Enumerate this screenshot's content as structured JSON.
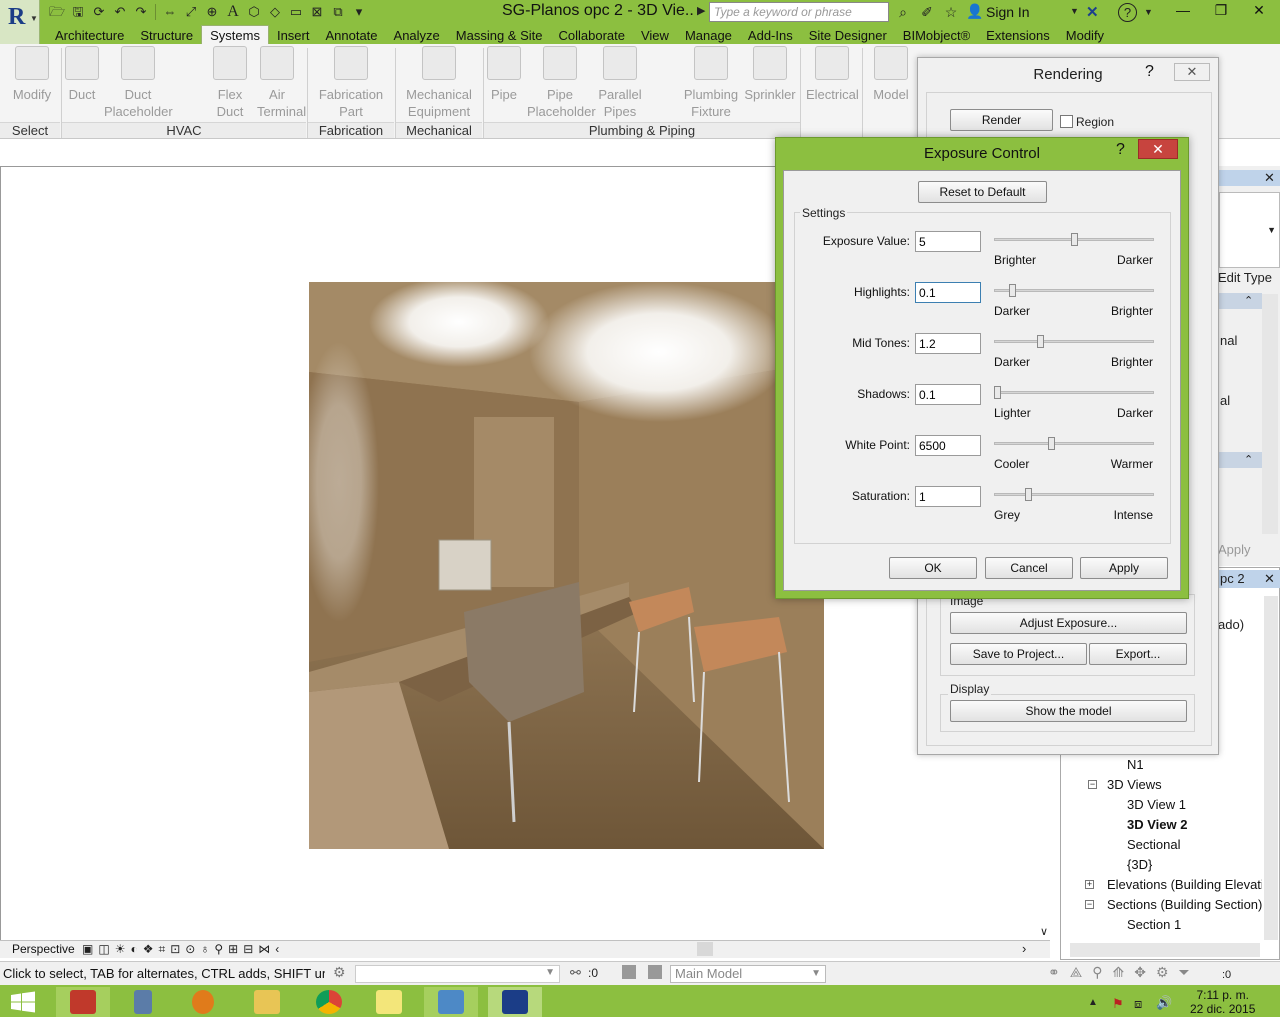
{
  "window": {
    "doc_title": "SG-Planos opc 2 - 3D Vie...",
    "search_placeholder": "Type a keyword or phrase",
    "signin_label": "Sign In",
    "minimize_label": "—",
    "restore_label": "❐",
    "close_label": "✕"
  },
  "menu_tabs": [
    "Architecture",
    "Structure",
    "Systems",
    "Insert",
    "Annotate",
    "Analyze",
    "Massing & Site",
    "Collaborate",
    "View",
    "Manage",
    "Add-Ins",
    "Site Designer",
    "BIMobject®",
    "Extensions",
    "Modify"
  ],
  "active_tab": "Systems",
  "ribbon": {
    "buttons": [
      {
        "label1": "Modify",
        "label2": ""
      },
      {
        "label1": "Duct",
        "label2": ""
      },
      {
        "label1": "Duct",
        "label2": "Placeholder"
      },
      {
        "label1": "Flex",
        "label2": "Duct"
      },
      {
        "label1": "Air",
        "label2": "Terminal"
      },
      {
        "label1": "Fabrication",
        "label2": "Part"
      },
      {
        "label1": "Mechanical",
        "label2": "Equipment"
      },
      {
        "label1": "Pipe",
        "label2": ""
      },
      {
        "label1": "Pipe",
        "label2": "Placeholder"
      },
      {
        "label1": "Parallel",
        "label2": "Pipes"
      },
      {
        "label1": "Plumbing",
        "label2": "Fixture"
      },
      {
        "label1": "Sprinkler",
        "label2": ""
      },
      {
        "label1": "Electrical",
        "label2": ""
      },
      {
        "label1": "Model",
        "label2": ""
      }
    ],
    "panels": [
      "Select",
      "HVAC",
      "Fabrication",
      "Mechanical",
      "Plumbing & Piping"
    ]
  },
  "view": {
    "mode_label": "Perspective"
  },
  "status": {
    "text": "Click to select, TAB for alternates, CTRL adds, SHIFT uns",
    "selection_count": ":0",
    "model": "Main Model",
    "filter_count": ":0"
  },
  "rendering_dialog": {
    "title": "Rendering",
    "help": "?",
    "render_button": "Render",
    "region_label": "Region",
    "image_group": "Image",
    "adjust_exposure": "Adjust Exposure...",
    "save_to_project": "Save to Project...",
    "export": "Export...",
    "display_group": "Display",
    "show_model": "Show the model"
  },
  "exposure_dialog": {
    "title": "Exposure Control",
    "help": "?",
    "reset_button": "Reset to Default",
    "settings_group": "Settings",
    "fields": [
      {
        "label": "Exposure Value:",
        "value": "5",
        "left": "Brighter",
        "right": "Darker",
        "slider_fraction": 0.5
      },
      {
        "label": "Highlights:",
        "value": "0.1",
        "left": "Darker",
        "right": "Brighter",
        "slider_fraction": 0.1
      },
      {
        "label": "Mid Tones:",
        "value": "1.2",
        "left": "Darker",
        "right": "Brighter",
        "slider_fraction": 0.28
      },
      {
        "label": "Shadows:",
        "value": "0.1",
        "left": "Lighter",
        "right": "Darker",
        "slider_fraction": 0.0
      },
      {
        "label": "White Point:",
        "value": "6500",
        "left": "Cooler",
        "right": "Warmer",
        "slider_fraction": 0.35
      },
      {
        "label": "Saturation:",
        "value": "1",
        "left": "Grey",
        "right": "Intense",
        "slider_fraction": 0.2
      }
    ],
    "ok": "OK",
    "cancel": "Cancel",
    "apply": "Apply"
  },
  "properties_panel": {
    "edit_type": "Edit Type",
    "apply": "Apply",
    "partial_1": "nal",
    "partial_2": "al"
  },
  "project_browser": {
    "title_partial": "pc 2",
    "partial_item": "ado)",
    "items": [
      {
        "label": "N1",
        "bold": false
      },
      {
        "label": "3D Views",
        "bold": false
      },
      {
        "label": "3D View 1",
        "bold": false
      },
      {
        "label": "3D View 2",
        "bold": true
      },
      {
        "label": "Sectional",
        "bold": false
      },
      {
        "label": "{3D}",
        "bold": false
      },
      {
        "label": "Elevations (Building Elevatic",
        "bold": false
      },
      {
        "label": "Sections (Building Section)",
        "bold": false
      },
      {
        "label": "Section 1",
        "bold": false
      }
    ]
  },
  "clock": {
    "time": "7:11 p. m.",
    "date": "22 dic. 2015"
  },
  "colors": {
    "accent": "#8cbf40",
    "close": "#c7443e"
  }
}
